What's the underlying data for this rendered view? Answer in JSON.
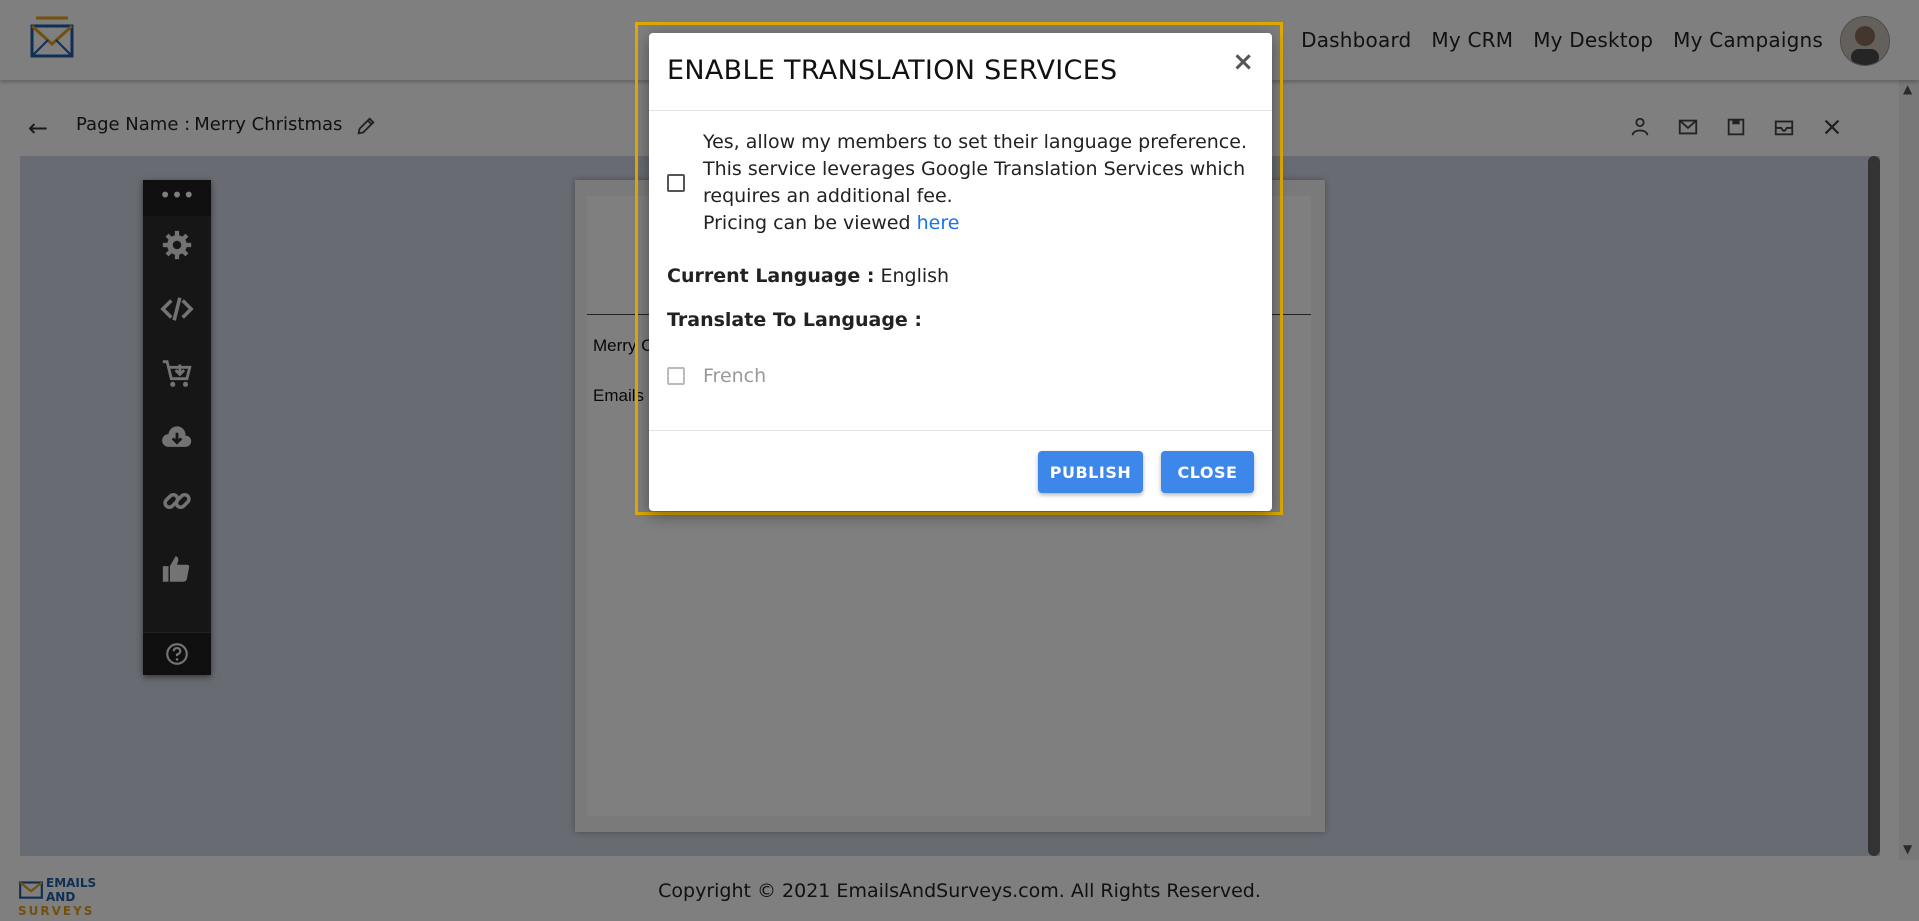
{
  "nav": {
    "items": [
      "Dashboard",
      "My CRM",
      "My Desktop",
      "My Campaigns"
    ]
  },
  "editor": {
    "page_name_label": "Page Name :",
    "page_name_value": "Merry Christmas"
  },
  "document": {
    "line1": "Merry C",
    "line2": "Emails"
  },
  "footer": {
    "logo_line1": "EMAILS AND",
    "logo_line2": "SURVEYS",
    "copyright": "Copyright © 2021 EmailsAndSurveys.com. All Rights Reserved."
  },
  "modal": {
    "title": "ENABLE TRANSLATION SERVICES",
    "close_x": "×",
    "optin_line1": "Yes, allow my members to set their language preference.",
    "optin_line2": "This service leverages Google Translation Services which",
    "optin_line3": "requires an additional fee.",
    "pricing_text": "Pricing can be viewed ",
    "pricing_link": "here",
    "current_language_label": "Current Language :",
    "current_language_value": "English",
    "translate_to_label": "Translate To Language :",
    "languages": [
      "French"
    ],
    "publish_label": "PUBLISH",
    "close_label": "CLOSE"
  },
  "colors": {
    "accent_button": "#3d86ea",
    "highlight_border": "#e0a800",
    "link": "#1a73e8",
    "toolbar_bg": "#2d2d2d"
  }
}
